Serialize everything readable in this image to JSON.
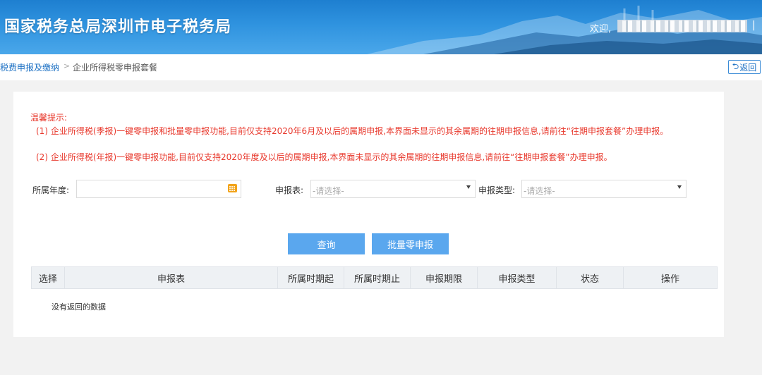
{
  "header": {
    "title": "国家税务总局深圳市电子税务局",
    "welcome": "欢迎,",
    "separator": "|"
  },
  "breadcrumb": {
    "parent": "税费申报及缴纳",
    "separator": ">",
    "current": "企业所得税零申报套餐"
  },
  "back_button": {
    "icon": "return-arrow-icon",
    "label": "返回"
  },
  "notice": {
    "title": "温馨提示:",
    "items": [
      "(1) 企业所得税(季报)一键零申报和批量零申报功能,目前仅支持2020年6月及以后的属期申报,本界面未显示的其余属期的往期申报信息,请前往“往期申报套餐”办理申报。",
      "(2) 企业所得税(年报)一键零申报功能,目前仅支持2020年度及以后的属期申报,本界面未显示的其余属期的往期申报信息,请前往“往期申报套餐”办理申报。"
    ]
  },
  "filters": {
    "year_label": "所属年度:",
    "year_value": "",
    "year_icon": "calendar-icon",
    "form_label": "申报表:",
    "form_placeholder": "-请选择-",
    "type_label": "申报类型:",
    "type_placeholder": "-请选择-"
  },
  "actions": {
    "query_label": "查询",
    "batch_label": "批量零申报"
  },
  "table": {
    "columns": [
      "选择",
      "申报表",
      "所属时期起",
      "所属时期止",
      "申报期限",
      "申报类型",
      "状态",
      "操作"
    ],
    "empty_text": "没有返回的数据"
  },
  "colors": {
    "header_blue": "#2f93df",
    "notice_red": "#e8382c",
    "button_blue": "#5aa7ee",
    "link_blue": "#1a6fc3"
  }
}
